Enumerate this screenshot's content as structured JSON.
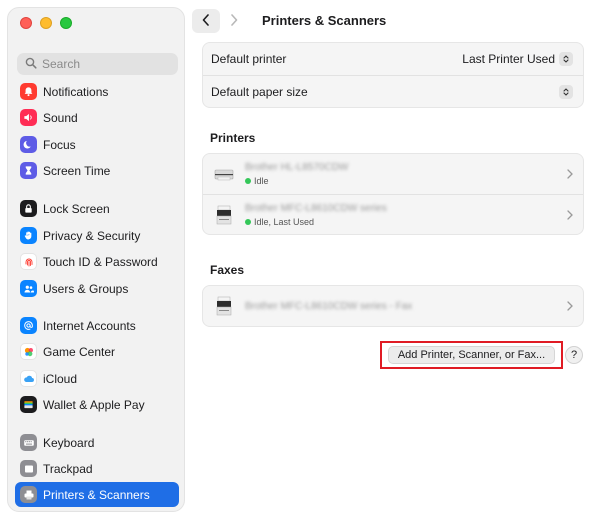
{
  "window": {
    "title": "Printers & Scanners"
  },
  "search": {
    "placeholder": "Search"
  },
  "sidebar": {
    "items": [
      {
        "label": "Notifications",
        "icon": "bell-icon",
        "color": "#ff3b30"
      },
      {
        "label": "Sound",
        "icon": "speaker-icon",
        "color": "#ff2d55"
      },
      {
        "label": "Focus",
        "icon": "moon-icon",
        "color": "#5e5ce6"
      },
      {
        "label": "Screen Time",
        "icon": "hourglass-icon",
        "color": "#5e5ce6"
      },
      {
        "label": "Lock Screen",
        "icon": "lock-icon",
        "color": "#1c1c1e"
      },
      {
        "label": "Privacy & Security",
        "icon": "hand-icon",
        "color": "#0a84ff"
      },
      {
        "label": "Touch ID & Password",
        "icon": "fingerprint-icon",
        "color": "#ff3b30"
      },
      {
        "label": "Users & Groups",
        "icon": "users-icon",
        "color": "#0a84ff"
      },
      {
        "label": "Internet Accounts",
        "icon": "at-icon",
        "color": "#0a84ff"
      },
      {
        "label": "Game Center",
        "icon": "game-center-icon",
        "color": "#ff9500"
      },
      {
        "label": "iCloud",
        "icon": "cloud-icon",
        "color": "#5ac8fa"
      },
      {
        "label": "Wallet & Apple Pay",
        "icon": "wallet-icon",
        "color": "#1c1c1e"
      },
      {
        "label": "Keyboard",
        "icon": "keyboard-icon",
        "color": "#8e8e93"
      },
      {
        "label": "Trackpad",
        "icon": "trackpad-icon",
        "color": "#8e8e93"
      },
      {
        "label": "Printers & Scanners",
        "icon": "printer-icon",
        "color": "#8e8e93",
        "active": true
      }
    ]
  },
  "settings": {
    "default_printer_label": "Default printer",
    "default_printer_value": "Last Printer Used",
    "default_paper_label": "Default paper size"
  },
  "printers": {
    "title": "Printers",
    "items": [
      {
        "name": "Brother HL-L8570CDW",
        "status": "Idle"
      },
      {
        "name": "Brother MFC-L8610CDW series",
        "status": "Idle, Last Used"
      }
    ]
  },
  "faxes": {
    "title": "Faxes",
    "items": [
      {
        "name": "Brother MFC-L8610CDW series - Fax"
      }
    ]
  },
  "actions": {
    "add_label": "Add Printer, Scanner, or Fax...",
    "help_label": "?"
  },
  "colors": {
    "accent": "#1f6ee6",
    "highlight_border": "#e01b24",
    "status_green": "#34c759"
  }
}
